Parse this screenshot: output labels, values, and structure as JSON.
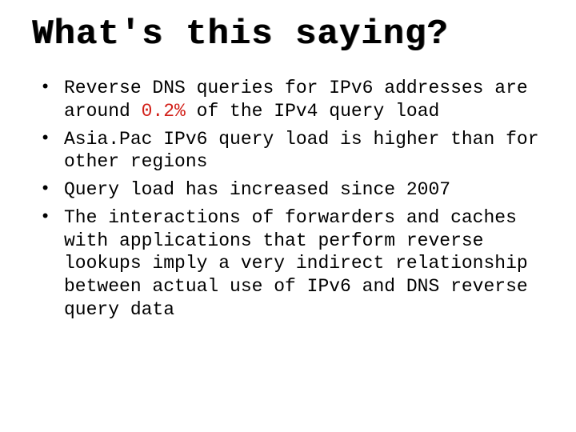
{
  "title": "What's this saying?",
  "bullets": [
    {
      "pre": "Reverse DNS queries for IPv6 addresses are around ",
      "highlight": "0.2%",
      "post": " of the IPv4 query load"
    },
    {
      "text": "Asia.Pac IPv6 query load is higher than for other regions"
    },
    {
      "text": "Query load has increased since 2007"
    },
    {
      "text": "The interactions of forwarders and caches with applications that perform reverse lookups imply a very indirect relationship between actual use of IPv6 and DNS reverse query data"
    }
  ]
}
